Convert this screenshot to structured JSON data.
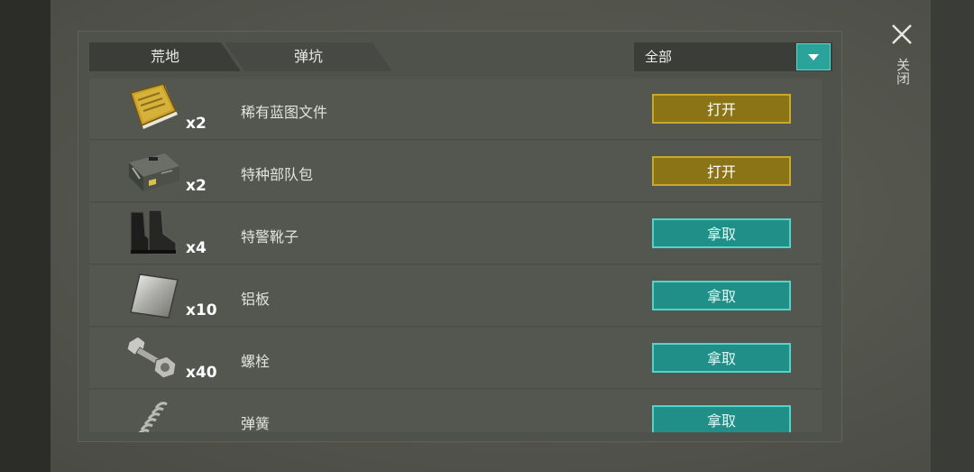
{
  "tabs": [
    {
      "label": "荒地"
    },
    {
      "label": "弹坑"
    }
  ],
  "filter": {
    "selected": "全部"
  },
  "items": [
    {
      "name": "稀有蓝图文件",
      "qty": "x2",
      "icon": "blueprint-folder-icon",
      "action": "打开",
      "action_type": "open"
    },
    {
      "name": "特种部队包",
      "qty": "x2",
      "icon": "military-crate-icon",
      "action": "打开",
      "action_type": "open"
    },
    {
      "name": "特警靴子",
      "qty": "x4",
      "icon": "boots-icon",
      "action": "拿取",
      "action_type": "take"
    },
    {
      "name": "铝板",
      "qty": "x10",
      "icon": "aluminum-plate-icon",
      "action": "拿取",
      "action_type": "take"
    },
    {
      "name": "螺栓",
      "qty": "x40",
      "icon": "bolt-icon",
      "action": "拿取",
      "action_type": "take"
    },
    {
      "name": "弹簧",
      "qty": "",
      "icon": "spring-icon",
      "action": "拿取",
      "action_type": "take"
    }
  ],
  "close": {
    "label": "关闭"
  },
  "colors": {
    "open_button": "#8a7416",
    "take_button": "#1f8f87",
    "accent": "#2aa39a"
  }
}
